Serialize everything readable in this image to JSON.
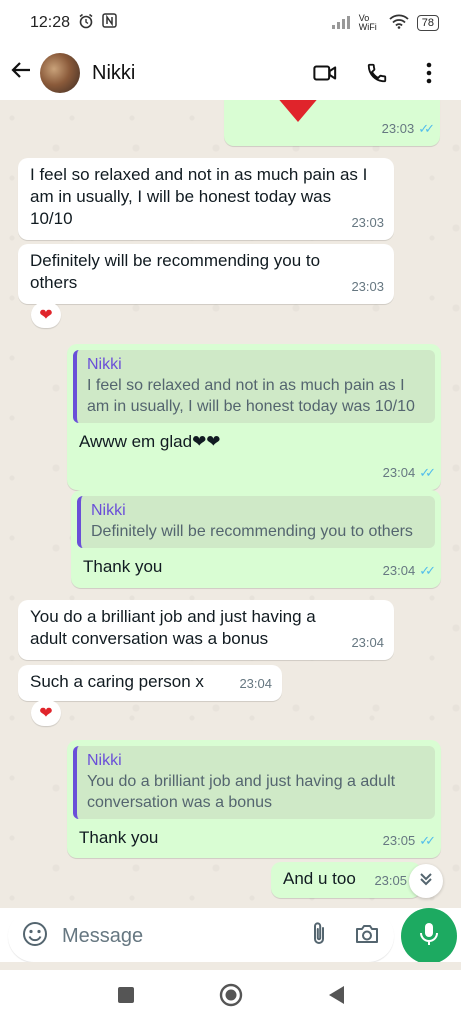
{
  "status_bar": {
    "time": "12:28",
    "network_label": "Vo WiFi",
    "battery": "78"
  },
  "header": {
    "contact_name": "Nikki"
  },
  "messages": [
    {
      "kind": "out",
      "time": "23:03",
      "has_heart": true
    },
    {
      "kind": "in",
      "text": "I feel so relaxed and not in as much pain as I am in usually, I will be honest today was 10/10",
      "time": "23:03"
    },
    {
      "kind": "in",
      "text": "Definitely will be recommending you to others",
      "time": "23:03",
      "reaction": "❤"
    },
    {
      "kind": "out",
      "quote_name": "Nikki",
      "quote_text": "I feel so relaxed and not in as much pain as I am in usually, I will be honest today was 10/10",
      "text": "Awww em glad❤❤",
      "time": "23:04"
    },
    {
      "kind": "out",
      "quote_name": "Nikki",
      "quote_text": "Definitely will be recommending you to others",
      "text": "Thank you",
      "time": "23:04"
    },
    {
      "kind": "in",
      "text": "You do a brilliant job and just having a adult conversation was a bonus",
      "time": "23:04"
    },
    {
      "kind": "in",
      "text": "Such a caring person x",
      "time": "23:04",
      "reaction": "❤"
    },
    {
      "kind": "out",
      "quote_name": "Nikki",
      "quote_text": "You do a brilliant job and just having a adult conversation was a bonus",
      "text": "Thank you",
      "time": "23:05"
    },
    {
      "kind": "out",
      "text": "And u too",
      "time": "23:05"
    }
  ],
  "composer": {
    "placeholder": "Message"
  },
  "colors": {
    "chat_bg": "#efeae2",
    "incoming": "#ffffff",
    "outgoing": "#d9fdd3",
    "accent_green": "#1daa61",
    "read_ticks": "#53bdeb",
    "quote_bar": "#6a4fd8"
  },
  "icons": {
    "back": "arrow-left-icon",
    "video": "video-call-icon",
    "call": "phone-icon",
    "menu": "more-vertical-icon",
    "emoji": "emoji-icon",
    "attach": "paperclip-icon",
    "camera": "camera-icon",
    "mic": "mic-icon",
    "scroll": "double-chevron-down-icon"
  }
}
